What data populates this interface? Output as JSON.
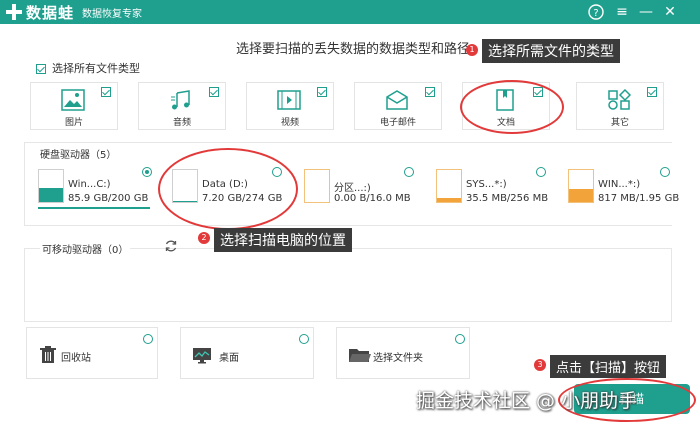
{
  "titlebar": {
    "logo_text": "数据蛙",
    "subtitle": "数据恢复专家",
    "help_icon": "help-icon",
    "menu_icon": "menu-icon",
    "min_icon": "minimize-icon",
    "close_icon": "close-icon"
  },
  "heading": "选择要扫描的丢失数据的数据类型和路径。",
  "select_all": "选择所有文件类型",
  "file_types": [
    {
      "label": "图片",
      "icon": "image-icon",
      "checked": true
    },
    {
      "label": "音频",
      "icon": "music-icon",
      "checked": true
    },
    {
      "label": "视频",
      "icon": "video-icon",
      "checked": true
    },
    {
      "label": "电子邮件",
      "icon": "email-icon",
      "checked": true
    },
    {
      "label": "文档",
      "icon": "document-icon",
      "checked": true
    },
    {
      "label": "其它",
      "icon": "other-icon",
      "checked": true
    }
  ],
  "hard_drives": {
    "title": "硬盘驱动器（5）",
    "drives": [
      {
        "name": "Win...C:)",
        "size": "85.9 GB/200 GB",
        "fill": 0.43,
        "color": "#1f9f8e",
        "selected": true
      },
      {
        "name": "Data (D:)",
        "size": "7.20 GB/274 GB",
        "fill": 0.03,
        "color": "#1f9f8e",
        "selected": false
      },
      {
        "name": "分区...:)",
        "size": "0.00  B/16.0 MB",
        "fill": 0.0,
        "color": "#f2a33a",
        "selected": false
      },
      {
        "name": "SYS...*:)",
        "size": "35.5 MB/256 MB",
        "fill": 0.14,
        "color": "#f2a33a",
        "selected": false
      },
      {
        "name": "WIN...*:)",
        "size": "817 MB/1.95 GB",
        "fill": 0.42,
        "color": "#f2a33a",
        "selected": false
      }
    ]
  },
  "removable": {
    "title": "可移动驱动器（0）",
    "refresh_icon": "refresh-icon"
  },
  "locations": [
    {
      "label": "回收站",
      "icon": "recycle-bin-icon"
    },
    {
      "label": "桌面",
      "icon": "desktop-icon"
    },
    {
      "label": "选择文件夹",
      "icon": "folder-icon"
    }
  ],
  "annotations": [
    {
      "num": "1",
      "text": "选择所需文件的类型"
    },
    {
      "num": "2",
      "text": "选择扫描电脑的位置"
    },
    {
      "num": "3",
      "text": "点击【扫描】按钮"
    }
  ],
  "scan_button": "扫描",
  "watermark": "掘金技术社区 @ 小朋助手",
  "colors": {
    "accent": "#1f9f8e",
    "annotation": "#e23a3a",
    "warn_fill": "#f2a33a"
  }
}
